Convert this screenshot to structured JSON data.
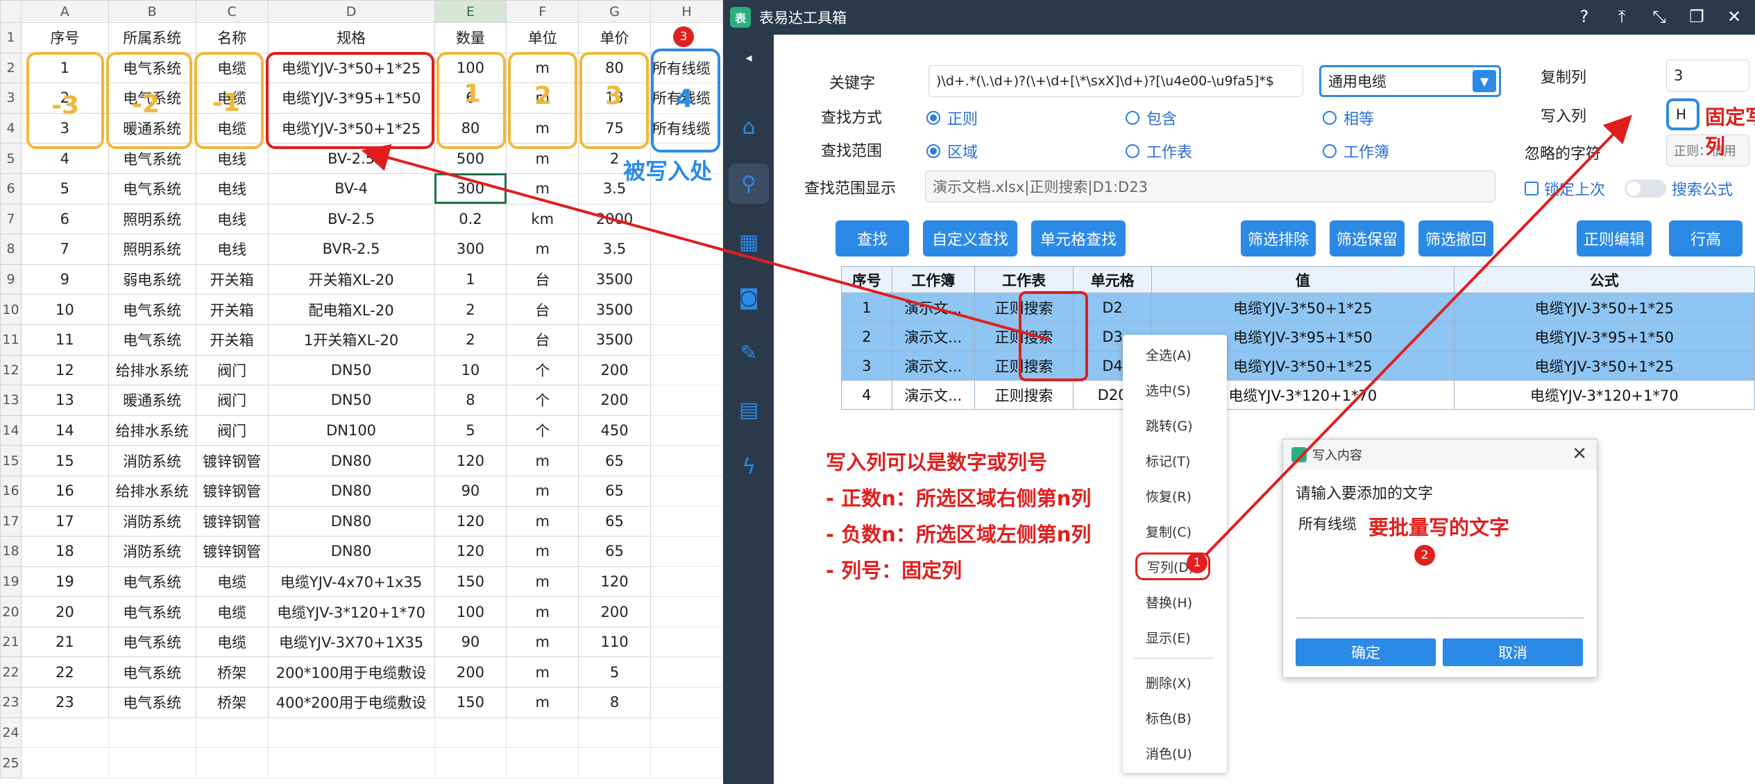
{
  "sheet": {
    "col_headers": [
      "",
      "A",
      "B",
      "C",
      "D",
      "E",
      "F",
      "G",
      "H"
    ],
    "rows": [
      {
        "n": "1",
        "cells": [
          "序号",
          "所属系统",
          "名称",
          "规格",
          "数量",
          "单位",
          "单价",
          ""
        ]
      },
      {
        "n": "2",
        "cells": [
          "1",
          "电气系统",
          "电缆",
          "电缆YJV-3*50+1*25",
          "100",
          "m",
          "80",
          "所有线缆"
        ]
      },
      {
        "n": "3",
        "cells": [
          "2",
          "电气系统",
          "电缆",
          "电缆YJV-3*95+1*50",
          "6",
          "m",
          "13",
          "所有线缆"
        ]
      },
      {
        "n": "4",
        "cells": [
          "3",
          "暖通系统",
          "电缆",
          "电缆YJV-3*50+1*25",
          "80",
          "m",
          "75",
          "所有线缆"
        ]
      },
      {
        "n": "5",
        "cells": [
          "4",
          "电气系统",
          "电线",
          "BV-2.5",
          "500",
          "m",
          "2",
          ""
        ]
      },
      {
        "n": "6",
        "cells": [
          "5",
          "电气系统",
          "电线",
          "BV-4",
          "300",
          "m",
          "3.5",
          ""
        ]
      },
      {
        "n": "7",
        "cells": [
          "6",
          "照明系统",
          "电线",
          "BV-2.5",
          "0.2",
          "km",
          "2000",
          ""
        ]
      },
      {
        "n": "8",
        "cells": [
          "7",
          "照明系统",
          "电线",
          "BVR-2.5",
          "300",
          "m",
          "3.5",
          ""
        ]
      },
      {
        "n": "9",
        "cells": [
          "9",
          "弱电系统",
          "开关箱",
          "开关箱XL-20",
          "1",
          "台",
          "3500",
          ""
        ]
      },
      {
        "n": "10",
        "cells": [
          "10",
          "电气系统",
          "开关箱",
          "配电箱XL-20",
          "2",
          "台",
          "3500",
          ""
        ]
      },
      {
        "n": "11",
        "cells": [
          "11",
          "电气系统",
          "开关箱",
          "1开关箱XL-20",
          "2",
          "台",
          "3500",
          ""
        ]
      },
      {
        "n": "12",
        "cells": [
          "12",
          "给排水系统",
          "阀门",
          "DN50",
          "10",
          "个",
          "200",
          ""
        ]
      },
      {
        "n": "13",
        "cells": [
          "13",
          "暖通系统",
          "阀门",
          "DN50",
          "8",
          "个",
          "200",
          ""
        ]
      },
      {
        "n": "14",
        "cells": [
          "14",
          "给排水系统",
          "阀门",
          "DN100",
          "5",
          "个",
          "450",
          ""
        ]
      },
      {
        "n": "15",
        "cells": [
          "15",
          "消防系统",
          "镀锌钢管",
          "DN80",
          "120",
          "m",
          "65",
          ""
        ]
      },
      {
        "n": "16",
        "cells": [
          "16",
          "给排水系统",
          "镀锌钢管",
          "DN80",
          "90",
          "m",
          "65",
          ""
        ]
      },
      {
        "n": "17",
        "cells": [
          "17",
          "消防系统",
          "镀锌钢管",
          "DN80",
          "120",
          "m",
          "65",
          ""
        ]
      },
      {
        "n": "18",
        "cells": [
          "18",
          "消防系统",
          "镀锌钢管",
          "DN80",
          "120",
          "m",
          "65",
          ""
        ]
      },
      {
        "n": "19",
        "cells": [
          "19",
          "电气系统",
          "电缆",
          "电缆YJV-4x70+1x35",
          "150",
          "m",
          "120",
          ""
        ]
      },
      {
        "n": "20",
        "cells": [
          "20",
          "电气系统",
          "电缆",
          "电缆YJV-3*120+1*70",
          "100",
          "m",
          "200",
          ""
        ]
      },
      {
        "n": "21",
        "cells": [
          "21",
          "电气系统",
          "电缆",
          "电缆YJV-3X70+1X35",
          "90",
          "m",
          "110",
          ""
        ]
      },
      {
        "n": "22",
        "cells": [
          "22",
          "电气系统",
          "桥架",
          "200*100用于电缆敷设",
          "200",
          "m",
          "5",
          ""
        ]
      },
      {
        "n": "23",
        "cells": [
          "23",
          "电气系统",
          "桥架",
          "400*200用于电缆敷设",
          "150",
          "m",
          "8",
          ""
        ]
      },
      {
        "n": "24",
        "cells": [
          "",
          "",
          "",
          "",
          "",
          "",
          "",
          ""
        ]
      },
      {
        "n": "25",
        "cells": [
          "",
          "",
          "",
          "",
          "",
          "",
          "",
          ""
        ]
      }
    ],
    "offset_labels": [
      "-3",
      "-2",
      "-1",
      "1",
      "2",
      "3",
      "4"
    ],
    "written_label": "被写入处"
  },
  "window": {
    "title": "表易达工具箱",
    "title_icons": [
      "help-icon",
      "pin-icon",
      "shrink-icon",
      "restore-icon",
      "close-icon"
    ],
    "sidebar_icons": [
      "collapse-arrow-icon",
      "home-icon",
      "search-icon",
      "grid-icon",
      "robot-icon",
      "broom-icon",
      "document-icon",
      "lightning-icon"
    ],
    "keyword_label": "关键字",
    "keyword_value": ")\\d+.*(\\.\\d+)?(\\+\\d+[\\*\\sxX]\\d+)?[\\u4e00-\\u9fa5]*$",
    "preset_value": "通用电缆",
    "copy_col_label": "复制列",
    "copy_col_value": "3",
    "write_col_label": "写入列",
    "write_col_value": "H",
    "ignore_label": "忽略的字符",
    "ignore_placeholder": "正则：慎用",
    "find_mode_label": "查找方式",
    "find_modes": [
      "正则",
      "包含",
      "相等"
    ],
    "find_range_label": "查找范围",
    "find_ranges": [
      "区域",
      "工作表",
      "工作簿"
    ],
    "range_display_label": "查找范围显示",
    "range_display_value": "演示文档.xlsx|正则搜索|D1:D23",
    "lock_label": "锁定上次",
    "search_formula_label": "搜索公式",
    "buttons": [
      "查找",
      "自定义查找",
      "单元格查找",
      "筛选排除",
      "筛选保留",
      "筛选撤回",
      "正则编辑",
      "行高"
    ],
    "result_headers": [
      "序号",
      "工作簿",
      "工作表",
      "单元格",
      "值",
      "公式"
    ],
    "results": [
      [
        "1",
        "演示文...",
        "正则搜索",
        "D2",
        "电缆YJV-3*50+1*25",
        "电缆YJV-3*50+1*25"
      ],
      [
        "2",
        "演示文...",
        "正则搜索",
        "D3",
        "电缆YJV-3*95+1*50",
        "电缆YJV-3*95+1*50"
      ],
      [
        "3",
        "演示文...",
        "正则搜索",
        "D4",
        "电缆YJV-3*50+1*25",
        "电缆YJV-3*50+1*25"
      ],
      [
        "4",
        "演示文...",
        "正则搜索",
        "D20",
        "电缆YJV-3*120+1*70",
        "电缆YJV-3*120+1*70"
      ]
    ]
  },
  "context_menu": [
    "全选(A)",
    "选中(S)",
    "跳转(G)",
    "标记(T)",
    "恢复(R)",
    "复制(C)",
    "写列(D)",
    "替换(H)",
    "显示(E)",
    "删除(X)",
    "标色(B)",
    "消色(U)"
  ],
  "dialog": {
    "title": "写入内容",
    "prompt": "请输入要添加的文字",
    "text": "所有线缆",
    "ok": "确定",
    "cancel": "取消"
  },
  "annotations": {
    "fixed_h": "固定写H",
    "fixed_h2": "列",
    "batch_text": "要批量写的文字",
    "notes": [
      "写入列可以是数字或列号",
      "- 正数n：所选区域右侧第n列",
      "- 负数n：所选区域左侧第n列",
      "- 列号：固定列"
    ],
    "badges": [
      "1",
      "2",
      "3"
    ]
  },
  "colors": {
    "accent": "#2b8ae6",
    "annotation_red": "#e01e1e",
    "highlight_yellow": "#f0b83a",
    "highlight_blue": "#2b8ae6",
    "sidebar": "#2b3a4b",
    "selected_row": "#8ec5f2"
  }
}
